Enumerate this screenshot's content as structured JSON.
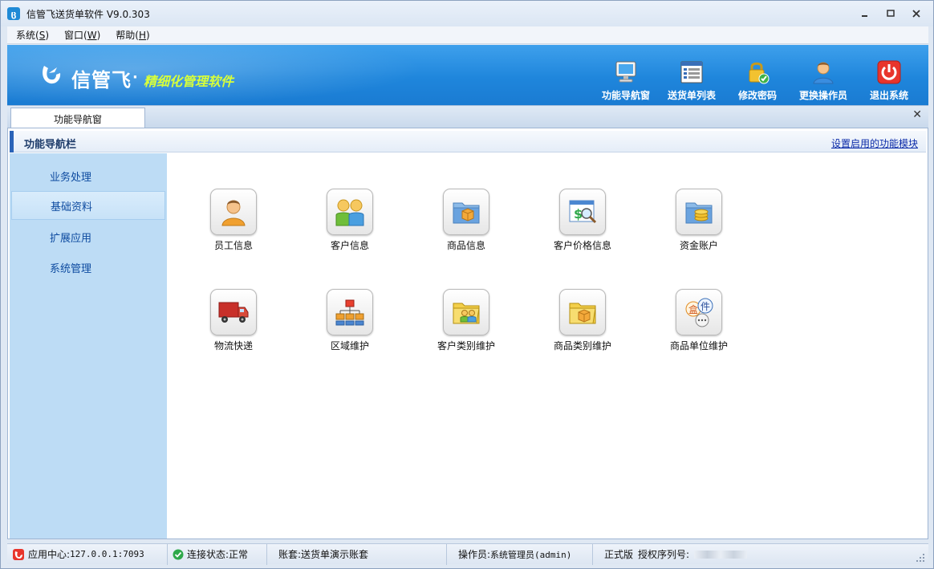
{
  "window": {
    "title": "信管飞送货单软件 V9.0.303"
  },
  "menu": {
    "items": [
      {
        "label": "系统",
        "hotkey": "S"
      },
      {
        "label": "窗口",
        "hotkey": "W"
      },
      {
        "label": "帮助",
        "hotkey": "H"
      }
    ]
  },
  "banner": {
    "logo_text": "信管飞",
    "separator": "·",
    "slogan": "精细化管理软件",
    "toolbar": [
      {
        "label": "功能导航窗",
        "icon": "monitor-icon"
      },
      {
        "label": "送货单列表",
        "icon": "list-icon"
      },
      {
        "label": "修改密码",
        "icon": "lock-icon"
      },
      {
        "label": "更换操作员",
        "icon": "user-icon"
      },
      {
        "label": "退出系统",
        "icon": "power-icon"
      }
    ]
  },
  "tabs": [
    {
      "label": "功能导航窗",
      "active": true
    }
  ],
  "nav_header": {
    "title": "功能导航栏",
    "link": "设置启用的功能模块"
  },
  "sidebar": {
    "items": [
      {
        "label": "业务处理",
        "active": false
      },
      {
        "label": "基础资料",
        "active": true
      },
      {
        "label": "扩展应用",
        "active": false
      },
      {
        "label": "系统管理",
        "active": false
      }
    ]
  },
  "modules": {
    "row1": [
      {
        "label": "员工信息",
        "icon": "employee-icon"
      },
      {
        "label": "客户信息",
        "icon": "customers-icon"
      },
      {
        "label": "商品信息",
        "icon": "product-folder-icon"
      },
      {
        "label": "客户价格信息",
        "icon": "price-icon"
      },
      {
        "label": "资金账户",
        "icon": "funds-account-icon"
      }
    ],
    "row2": [
      {
        "label": "物流快递",
        "icon": "truck-icon"
      },
      {
        "label": "区域维护",
        "icon": "region-tree-icon"
      },
      {
        "label": "客户类别维护",
        "icon": "customer-category-icon"
      },
      {
        "label": "商品类别维护",
        "icon": "product-category-icon"
      },
      {
        "label": "商品单位维护",
        "icon": "unit-icon"
      }
    ]
  },
  "unit_icon_text": {
    "box": "盒",
    "piece": "件"
  },
  "status": {
    "app_center_label": "应用中心:",
    "app_center_value": "127.0.0.1:7093",
    "connection_label": "连接状态:",
    "connection_value": "正常",
    "account_label": "账套:",
    "account_value": "送货单演示账套",
    "operator_label": "操作员:",
    "operator_value": "系统管理员(admin)",
    "edition": "正式版",
    "serial_label": "授权序列号:"
  },
  "colors": {
    "banner_blue": "#1f86dc",
    "slogan_yellow": "#d8ff3a",
    "sidebar_bg": "#bddcf5",
    "nav_text": "#0e4ba0"
  }
}
